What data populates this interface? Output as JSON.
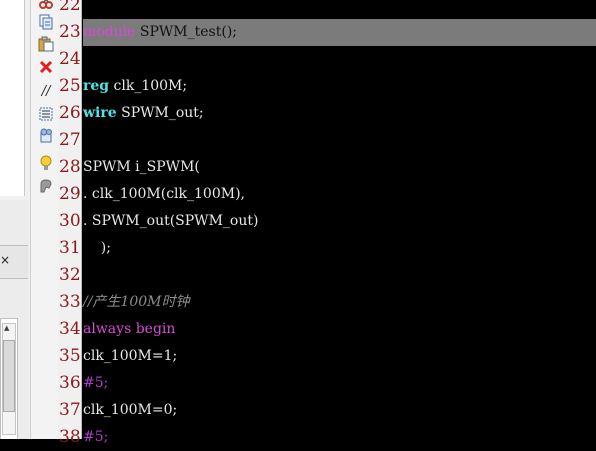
{
  "left_panel": {
    "close_glyph": "×"
  },
  "toolbar": {
    "icons": [
      "cut-icon",
      "copy-icon",
      "paste-icon",
      "delete-icon",
      "comment-icon",
      "column-select-icon",
      "bookmark-icon",
      "lightbulb-icon",
      "tools-icon"
    ]
  },
  "editor": {
    "line_numbers": [
      "22",
      "23",
      "24",
      "25",
      "26",
      "27",
      "28",
      "29",
      "30",
      "31",
      "32",
      "33",
      "34",
      "35",
      "36",
      "37",
      "38"
    ],
    "highlighted_line": "23",
    "lines": {
      "l23_kw": "module",
      "l23_rest": " SPWM_test();",
      "l25_kw": "reg",
      "l25_rest": " clk_100M;",
      "l26_kw": "wire",
      "l26_rest": " SPWM_out;",
      "l28": "SPWM i_SPWM(",
      "l29": ". clk_100M(clk_100M),",
      "l30": ". SPWM_out(SPWM_out)",
      "l31": "    );",
      "l33": "//产生100M时钟",
      "l34": "always begin",
      "l35": "clk_100M=1;",
      "l36": "#5;",
      "l37": "clk_100M=0;",
      "l38": "#5;"
    }
  },
  "colors": {
    "keyword_magenta": "#d84ad8",
    "keyword_cyan": "#4fe6e6",
    "line_number": "#8b1a1a",
    "highlight": "#7b7b7b",
    "background": "#000000"
  }
}
